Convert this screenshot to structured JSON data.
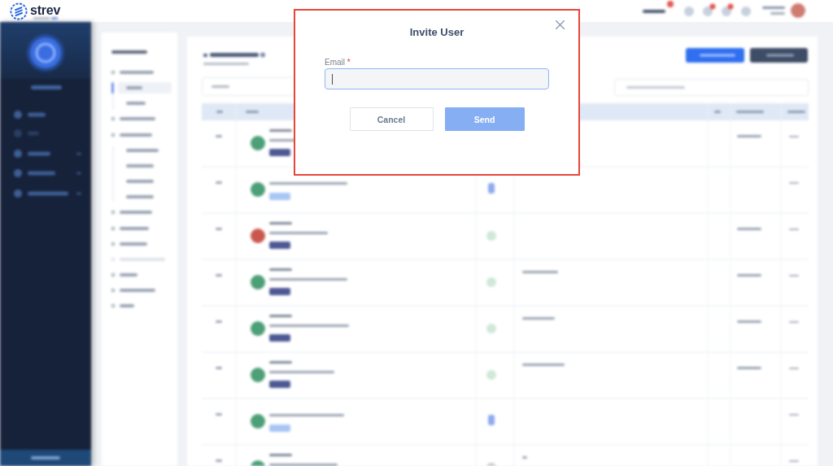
{
  "page": {
    "blurred": true
  },
  "logo": {
    "name": "strev"
  },
  "modal": {
    "title": "Invite User",
    "highlighted": true,
    "email_field": {
      "label": "Email",
      "required_mark": "*",
      "focused": true
    },
    "buttons": [
      {
        "label": "Cancel",
        "kind": "secondary",
        "disabled": false
      },
      {
        "label": "Send",
        "kind": "primary",
        "disabled": true
      }
    ]
  }
}
